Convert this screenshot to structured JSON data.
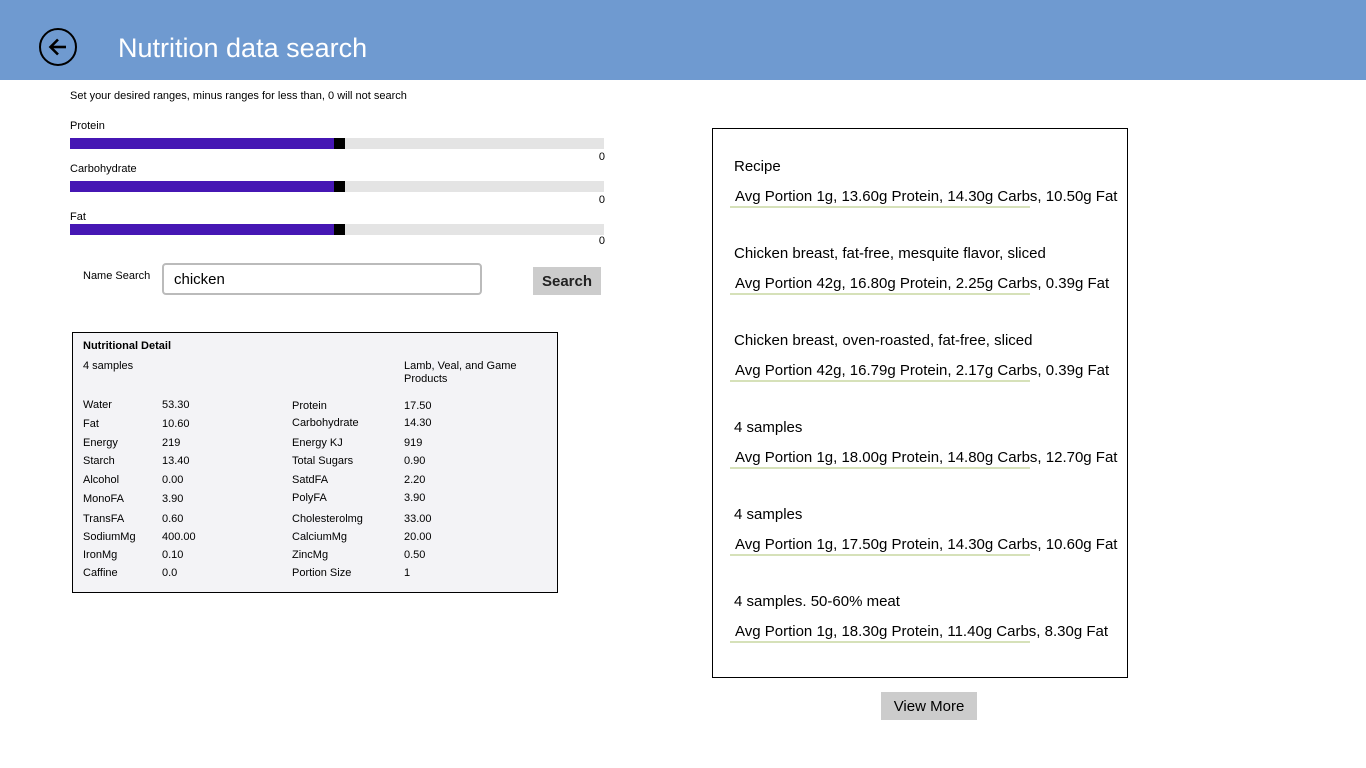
{
  "header": {
    "title": "Nutrition data search",
    "back_icon": "back-arrow-icon"
  },
  "filters": {
    "instructions": "Set your desired ranges, minus ranges for less than, 0 will not search",
    "sliders": [
      {
        "label": "Protein",
        "value": "0",
        "position_fraction": 0.5
      },
      {
        "label": "Carbohydrate",
        "value": "0",
        "position_fraction": 0.5
      },
      {
        "label": "Fat",
        "value": "0",
        "position_fraction": 0.5
      }
    ]
  },
  "search": {
    "label": "Name Search",
    "value": "chicken",
    "button": "Search"
  },
  "detail": {
    "title": "Nutritional Detail",
    "samples": "4 samples",
    "category": "Lamb, Veal, and Game Products",
    "rows": [
      {
        "l_name": "Water",
        "l_value": "53.30",
        "r_name": "Protein",
        "r_value": "17.50"
      },
      {
        "l_name": "Fat",
        "l_value": "10.60",
        "r_name": "Carbohydrate",
        "r_value": "14.30"
      },
      {
        "l_name": "Energy",
        "l_value": "219",
        "r_name": "Energy KJ",
        "r_value": "919"
      },
      {
        "l_name": "Starch",
        "l_value": "13.40",
        "r_name": "Total Sugars",
        "r_value": "0.90"
      },
      {
        "l_name": "Alcohol",
        "l_value": "0.00",
        "r_name": "SatdFA",
        "r_value": "2.20"
      },
      {
        "l_name": "MonoFA",
        "l_value": "3.90",
        "r_name": "PolyFA",
        "r_value": "3.90"
      },
      {
        "l_name": "TransFA",
        "l_value": "0.60",
        "r_name": "Cholesterolmg",
        "r_value": "33.00"
      },
      {
        "l_name": "SodiumMg",
        "l_value": "400.00",
        "r_name": "CalciumMg",
        "r_value": "20.00"
      },
      {
        "l_name": "IronMg",
        "l_value": "0.10",
        "r_name": "ZincMg",
        "r_value": "0.50"
      },
      {
        "l_name": "Caffine",
        "l_value": "0.0",
        "r_name": "Portion Size",
        "r_value": "1"
      }
    ]
  },
  "results": {
    "items": [
      {
        "title": "Recipe",
        "summary": "Avg Portion 1g, 13.60g Protein, 14.30g Carbs, 10.50g Fat"
      },
      {
        "title": "Chicken breast, fat-free, mesquite flavor, sliced",
        "summary": "Avg Portion 42g, 16.80g Protein, 2.25g Carbs, 0.39g Fat"
      },
      {
        "title": "Chicken breast, oven-roasted, fat-free, sliced",
        "summary": "Avg Portion 42g, 16.79g Protein, 2.17g Carbs, 0.39g Fat"
      },
      {
        "title": "4 samples",
        "summary": "Avg Portion 1g, 18.00g Protein, 14.80g Carbs, 12.70g Fat"
      },
      {
        "title": "4 samples",
        "summary": "Avg Portion 1g, 17.50g Protein, 14.30g Carbs, 10.60g Fat"
      },
      {
        "title": "4 samples. 50-60% meat",
        "summary": "Avg Portion 1g, 18.30g Protein, 11.40g Carbs, 8.30g Fat"
      }
    ],
    "view_more": "View More"
  },
  "colors": {
    "header_bg": "#6f9ad0",
    "slider_fill": "#4617b4",
    "slider_track": "#e4e4e4",
    "underline": "#d6e1b9",
    "button_bg": "#cccccc"
  }
}
